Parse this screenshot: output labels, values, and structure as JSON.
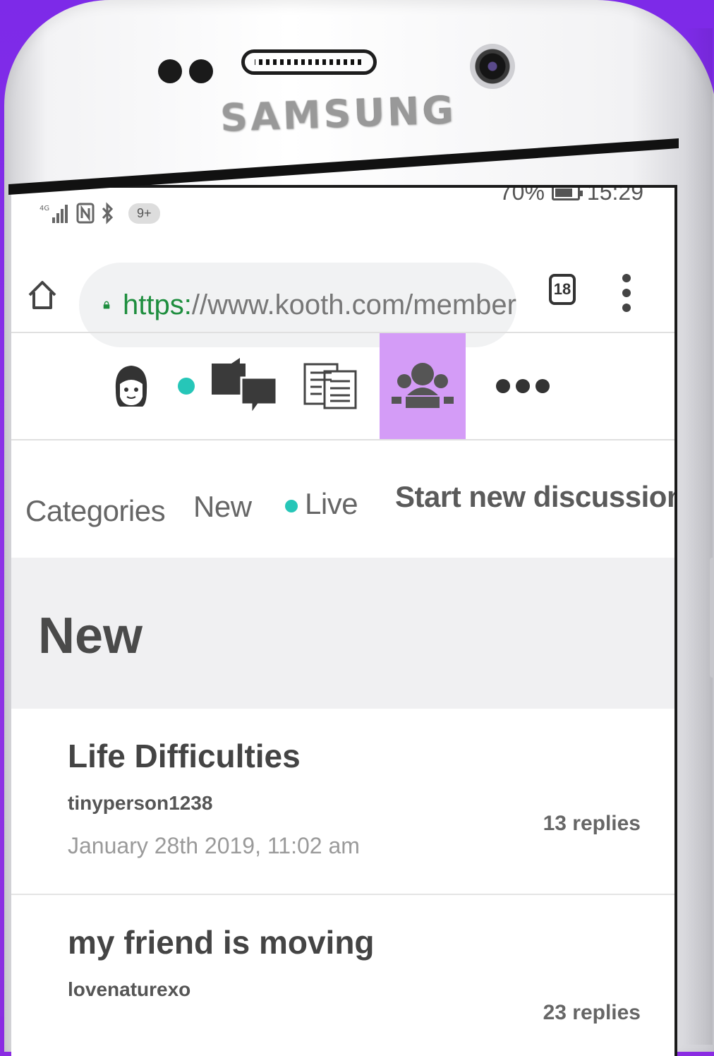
{
  "device": {
    "brand": "SAMSUNG"
  },
  "status_bar": {
    "signal": "4G",
    "notification_badge": "9+",
    "battery": "70%",
    "time": "15:29"
  },
  "browser": {
    "url_scheme": "https:",
    "url_rest": "//www.kooth.com/member",
    "tab_count": "18"
  },
  "icon_nav": {
    "items": [
      {
        "icon": "avatar-icon"
      },
      {
        "icon": "chat-bubbles-icon",
        "status": "online-dot"
      },
      {
        "icon": "articles-icon"
      },
      {
        "icon": "community-forum-icon",
        "active": true
      },
      {
        "icon": "more-icon"
      }
    ],
    "active_color": "#d49cf7",
    "dot_color": "#26c6b8"
  },
  "tabs": {
    "categories": "Categories",
    "new": "New",
    "live": "Live",
    "start": "Start new discussion"
  },
  "section": {
    "title": "New"
  },
  "discussions": [
    {
      "title": "Life Difficulties",
      "user": "tinyperson1238",
      "date": "January 28th 2019, 11:02 am",
      "replies": "13 replies"
    },
    {
      "title": "my friend is moving",
      "user": "lovenaturexo",
      "date": "",
      "replies": "23 replies"
    }
  ]
}
